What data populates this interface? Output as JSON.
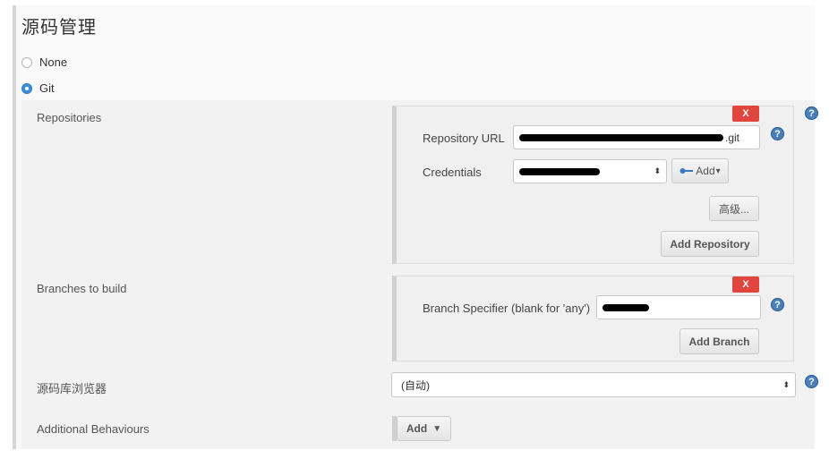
{
  "section": {
    "title": "源码管理"
  },
  "scm_options": {
    "none_label": "None",
    "git_label": "Git",
    "selected": "Git"
  },
  "repositories": {
    "label": "Repositories",
    "delete_label": "X",
    "url_label": "Repository URL",
    "url_value_suffix": ".git",
    "credentials_label": "Credentials",
    "add_credentials_label": "Add",
    "advanced_label": "高级...",
    "add_button_label": "Add Repository"
  },
  "branches": {
    "label": "Branches to build",
    "delete_label": "X",
    "specifier_label": "Branch Specifier (blank for 'any')",
    "add_button_label": "Add Branch"
  },
  "browser": {
    "label": "源码库浏览器",
    "selected_value": "(自动)"
  },
  "behaviours": {
    "label": "Additional Behaviours",
    "add_label": "Add"
  },
  "icons": {
    "help": "?",
    "select_arrows": "⬍",
    "key_icon": "key-icon"
  },
  "colors": {
    "delete": "#e0453e",
    "help": "#4a80b8",
    "radio_selected": "#3b8fd8"
  }
}
